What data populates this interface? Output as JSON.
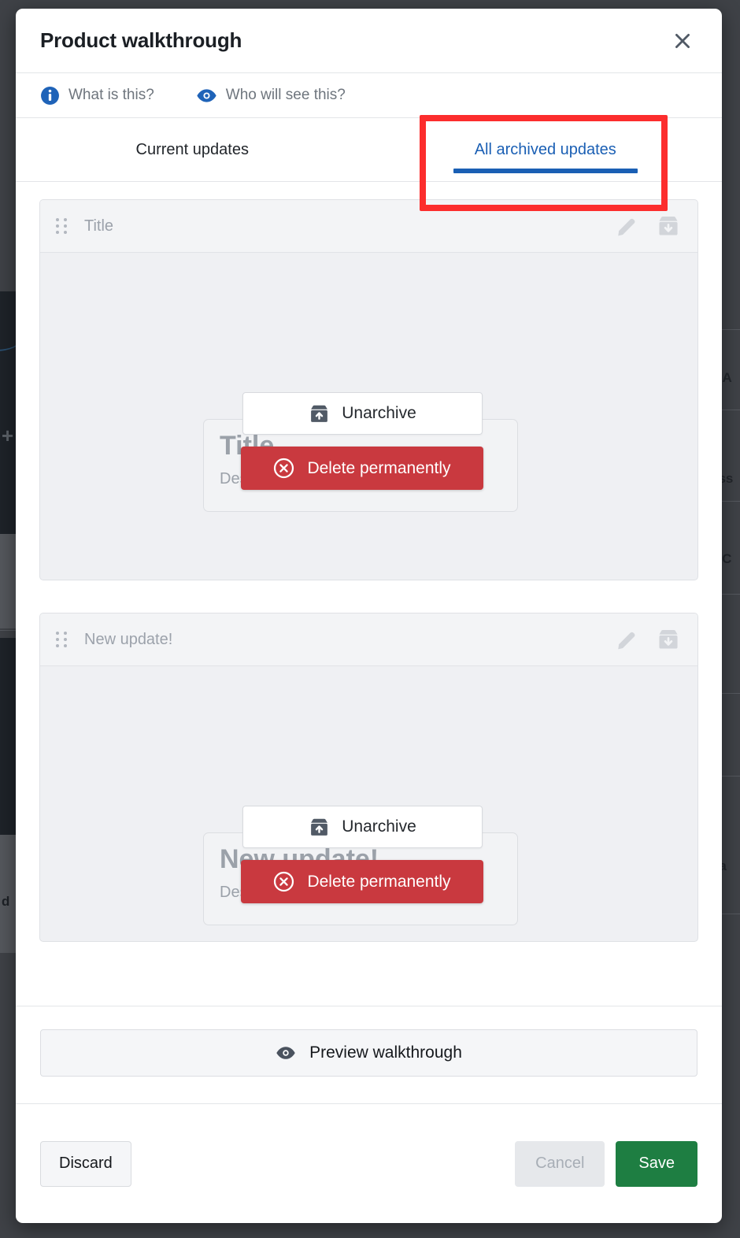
{
  "modal": {
    "title": "Product walkthrough",
    "close_icon": "close-icon"
  },
  "info_bar": {
    "links": [
      {
        "label": "What is this?",
        "icon": "info-circle-icon"
      },
      {
        "label": "Who will see this?",
        "icon": "eye-icon"
      }
    ]
  },
  "tabs": [
    {
      "label": "Current updates",
      "active": false
    },
    {
      "label": "All archived updates",
      "active": true
    }
  ],
  "cards": [
    {
      "header_title": "Title",
      "drag_icon": "drag-handle-icon",
      "edit_icon": "pencil-icon",
      "archive_icon": "archive-down-icon",
      "preview_title": "Title",
      "preview_description": "Description",
      "unarchive_label": "Unarchive",
      "unarchive_icon": "archive-up-icon",
      "delete_label": "Delete permanently",
      "delete_icon": "circle-x-icon"
    },
    {
      "header_title": "New update!",
      "drag_icon": "drag-handle-icon",
      "edit_icon": "pencil-icon",
      "archive_icon": "archive-down-icon",
      "preview_title": "New update!",
      "preview_description": "Description",
      "unarchive_label": "Unarchive",
      "unarchive_icon": "archive-up-icon",
      "delete_label": "Delete permanently",
      "delete_icon": "circle-x-icon"
    }
  ],
  "preview_walkthrough": {
    "label": "Preview walkthrough",
    "icon": "eye-icon"
  },
  "footer": {
    "discard_label": "Discard",
    "cancel_label": "Cancel",
    "save_label": "Save"
  },
  "annotation": {
    "type": "highlight-rectangle",
    "target": "All archived updates"
  },
  "colors": {
    "accent_blue": "#1a5fb4",
    "danger_red": "#c9393f",
    "save_green": "#1e7e42",
    "annotation_red": "#fc2d2d",
    "muted_text": "#9ba1a9",
    "icon_slate": "#515a66"
  },
  "background_page": {
    "fragments": [
      "n A",
      "ass",
      "v C",
      "na",
      "d"
    ]
  }
}
